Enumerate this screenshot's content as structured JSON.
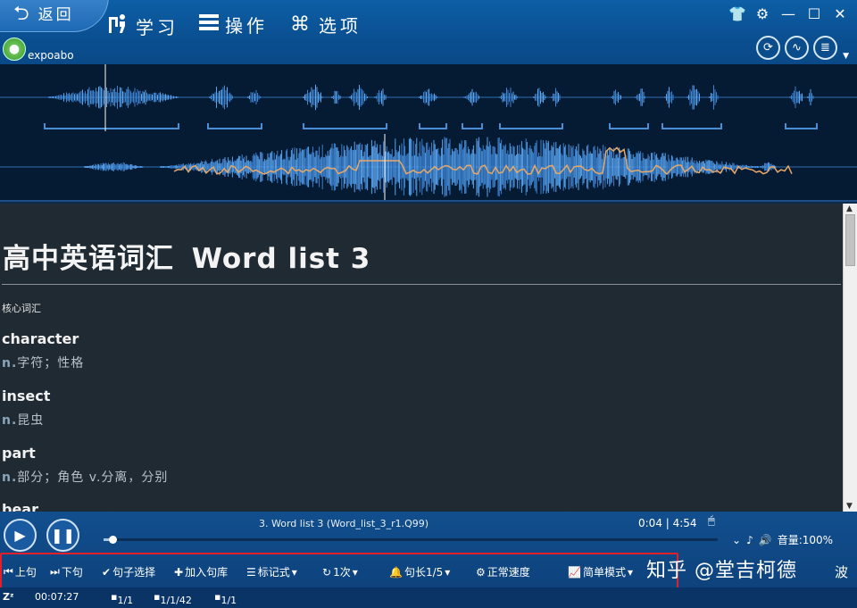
{
  "topbar": {
    "back_label": "返回",
    "menu": [
      {
        "label": "学习",
        "icon": "study-icon"
      },
      {
        "label": "操作",
        "icon": "menu-icon"
      },
      {
        "label": "选项",
        "icon": "options-icon"
      }
    ],
    "window_controls": [
      "shirt-icon",
      "gear-icon",
      "minimize-icon",
      "maximize-icon",
      "close-icon"
    ],
    "username": "expoabo"
  },
  "document": {
    "title_cn": "高中英语词汇",
    "title_en": "Word list 3",
    "subtitle": "核心词汇",
    "entries": [
      {
        "word": "character",
        "pos": "n.",
        "meaning": "字符；性格"
      },
      {
        "word": "insect",
        "pos": "n.",
        "meaning": "昆虫"
      },
      {
        "word": "part",
        "pos": "n.",
        "meaning": "部分；角色 v.分离，分别"
      },
      {
        "word": "bear",
        "pos": "",
        "meaning": ""
      }
    ]
  },
  "player": {
    "track_title": "3. Word list 3 (Word_list_3_r1.Q99)",
    "time": "0:04 | 4:54",
    "progress": 0.014,
    "volume_label": "音量:100%"
  },
  "toolbar": {
    "prev": "上句",
    "next": "下句",
    "sentence_select": "句子选择",
    "add_to_bank": "加入句库",
    "mark_style": "标记式",
    "repeat": "1次",
    "sentence_length": "句长1/5",
    "speed": "正常速度",
    "mode": "简单模式",
    "wave": "波"
  },
  "watermark": "知乎 @堂吉柯德",
  "statusbar": {
    "sleep": "Zᶻ",
    "elapsed": "00:07:27",
    "s1": "1/1",
    "s2": "1/1/42",
    "s3": "1/1"
  }
}
